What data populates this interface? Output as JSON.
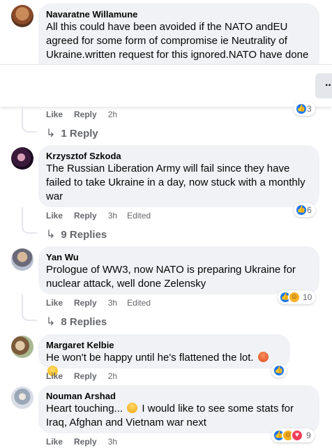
{
  "comments": [
    {
      "author": "Navaratne Willamune",
      "text": "All this could have been avoided if the NATO andEU agreed for some form of compromise ie Neutrality of Ukraine.written request for this ignored.NATO have done",
      "like": "Like",
      "reply": "Reply",
      "time": "2h",
      "reaction_count": "3",
      "replies": "1 Reply"
    },
    {
      "author": "Krzysztof Szkoda",
      "text": "The Russian Liberation Army will fail since they have failed to take Ukraine in a day, now stuck with a monthly war",
      "like": "Like",
      "reply": "Reply",
      "time": "3h",
      "edited": "Edited",
      "reaction_count": "6",
      "replies": "9 Replies"
    },
    {
      "author": "Yan Wu",
      "text": "Prologue of WW3, now NATO is preparing Ukraine for nuclear attack, well done Zelensky",
      "like": "Like",
      "reply": "Reply",
      "time": "3h",
      "edited": "Edited",
      "reaction_count": "10",
      "replies": "8 Replies"
    },
    {
      "author": "Margaret Kelbie",
      "text": "He won't be happy until he's flattened the lot.",
      "like": "Like",
      "reply": "Reply",
      "time": "2h"
    },
    {
      "author": "Nouman Arshad",
      "text_a": "Heart touching...",
      "text_b": "I would like to see some stats for Iraq, Afghan and Vietnam war next",
      "like": "Like",
      "reply": "Reply",
      "time": "3h",
      "reaction_count": "9"
    }
  ],
  "icons": {
    "like": "like-reaction-icon",
    "haha": "haha-reaction-icon",
    "love": "love-reaction-icon",
    "reply_arrow": "reply-arrow-icon",
    "more": "more-options-icon"
  },
  "colors": {
    "bubble": "#f0f2f5",
    "meta": "#65676b",
    "like_blue": "#1877f2"
  }
}
